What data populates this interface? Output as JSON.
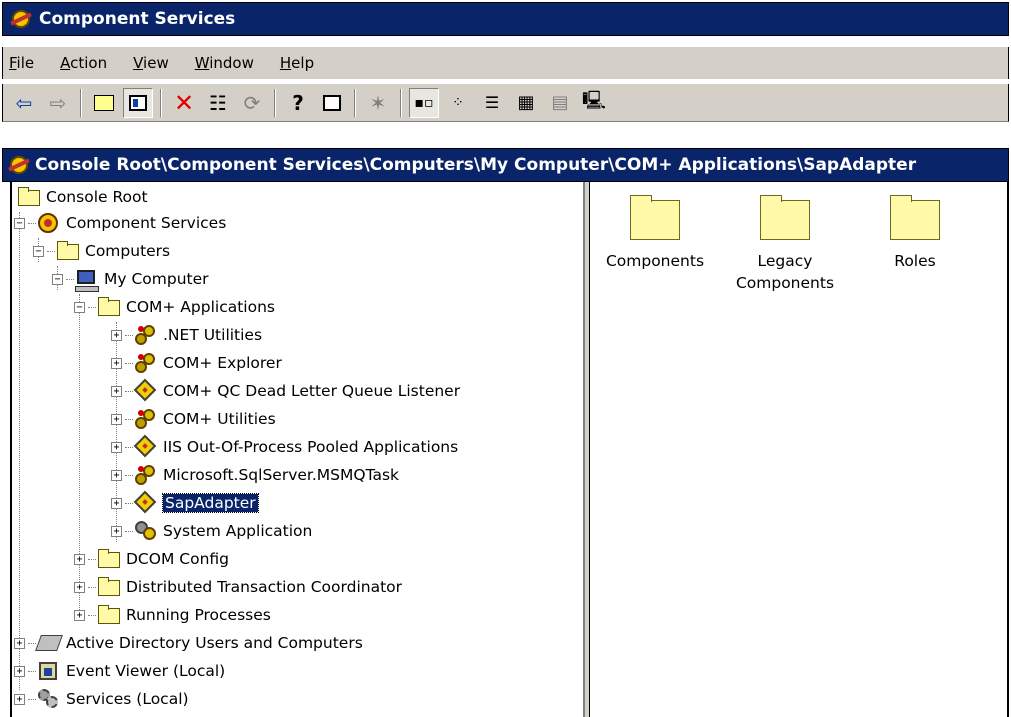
{
  "window": {
    "title": "Component Services"
  },
  "menu": [
    {
      "label": "File",
      "accel": "F",
      "rest": "ile"
    },
    {
      "label": "Action",
      "accel": "A",
      "rest": "ction"
    },
    {
      "label": "View",
      "accel": "V",
      "rest": "iew"
    },
    {
      "label": "Window",
      "accel": "W",
      "rest": "indow"
    },
    {
      "label": "Help",
      "accel": "H",
      "rest": "elp"
    }
  ],
  "toolbar": {
    "buttons": [
      "back-icon",
      "forward-icon",
      "up-folder-icon",
      "show-tree-icon",
      "delete-icon",
      "properties-icon",
      "refresh-icon",
      "help-icon",
      "export-icon",
      "new-window-icon",
      "large-icons-view-icon",
      "small-icons-view-icon",
      "list-view-icon",
      "detail-view-icon",
      "status-view-icon",
      "computer-icon"
    ]
  },
  "path": "Console Root\\Component Services\\Computers\\My Computer\\COM+ Applications\\SapAdapter",
  "tree": [
    {
      "label": "Console Root"
    },
    {
      "label": "Component Services"
    },
    {
      "label": "Computers"
    },
    {
      "label": "My Computer"
    },
    {
      "label": "COM+ Applications"
    },
    {
      "label": ".NET Utilities"
    },
    {
      "label": "COM+ Explorer"
    },
    {
      "label": "COM+ QC Dead Letter Queue Listener"
    },
    {
      "label": "COM+ Utilities"
    },
    {
      "label": "IIS Out-Of-Process Pooled Applications"
    },
    {
      "label": "Microsoft.SqlServer.MSMQTask"
    },
    {
      "label": "SapAdapter"
    },
    {
      "label": "System Application"
    },
    {
      "label": "DCOM Config"
    },
    {
      "label": "Distributed Transaction Coordinator"
    },
    {
      "label": "Running Processes"
    },
    {
      "label": "Active Directory Users and Computers"
    },
    {
      "label": "Event Viewer (Local)"
    },
    {
      "label": "Services (Local)"
    }
  ],
  "selected": "SapAdapter",
  "list_items": [
    {
      "label_line1": "Components",
      "label_line2": ""
    },
    {
      "label_line1": "Legacy",
      "label_line2": "Components"
    },
    {
      "label_line1": "Roles",
      "label_line2": ""
    }
  ],
  "colors": {
    "titlebar": "#0a246a",
    "chrome": "#d4d0c8",
    "folder": "#fff9a8"
  }
}
